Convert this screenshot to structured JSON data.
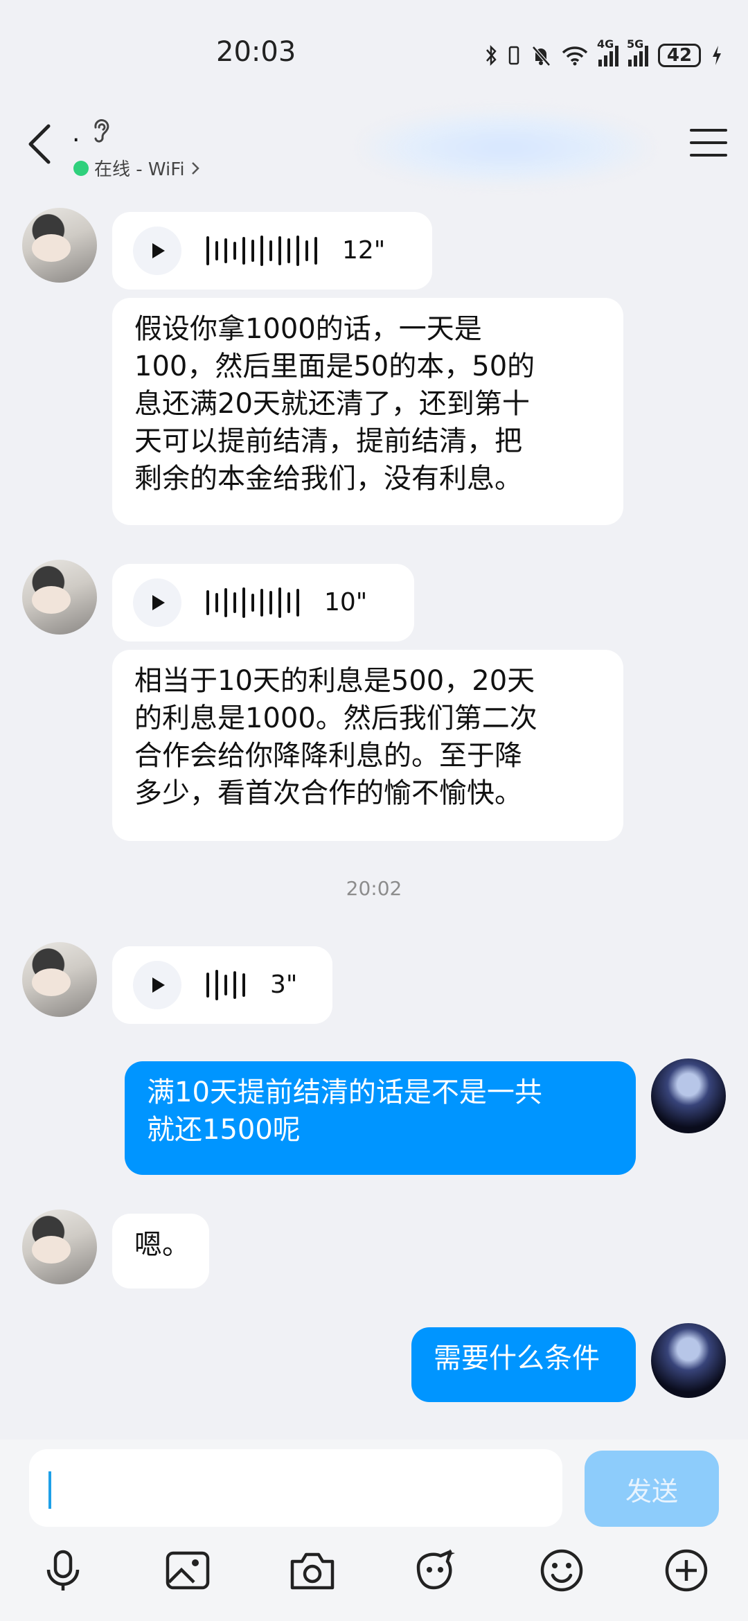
{
  "status_bar": {
    "time": "20:03",
    "battery": "42",
    "net1": "4G",
    "net2": "5G"
  },
  "header": {
    "contact_name": ".",
    "status": "在线 - WiFi",
    "online_color": "#2FD07C"
  },
  "messages": [
    {
      "kind": "voice",
      "from": "other",
      "duration": "12\""
    },
    {
      "kind": "text",
      "from": "other",
      "text": "假设你拿1000的话，一天是\n100，然后里面是50的本，50的\n息还满20天就还清了，还到第十\n天可以提前结清，提前结清，把\n剩余的本金给我们，没有利息。"
    },
    {
      "kind": "voice",
      "from": "other",
      "duration": "10\""
    },
    {
      "kind": "text",
      "from": "other",
      "text": "相当于10天的利息是500，20天\n的利息是1000。然后我们第二次\n合作会给你降降利息的。至于降\n多少，看首次合作的愉不愉快。"
    },
    {
      "kind": "voice",
      "from": "other",
      "duration": "3\""
    },
    {
      "kind": "text",
      "from": "me",
      "text": "满10天提前结清的话是不是一共\n就还1500呢"
    },
    {
      "kind": "text",
      "from": "other",
      "text": "嗯。"
    },
    {
      "kind": "text",
      "from": "me",
      "text": "需要什么条件"
    }
  ],
  "time_separator": "20:02",
  "input": {
    "value": "",
    "send_label": "发送"
  },
  "toolbar": [
    "mic-icon",
    "image-icon",
    "camera-icon",
    "sticker-icon",
    "emoji-icon",
    "plus-icon"
  ],
  "colors": {
    "my_bubble": "#0095FF",
    "send_disabled": "#8DCCFB",
    "background": "#F0F1F5"
  }
}
